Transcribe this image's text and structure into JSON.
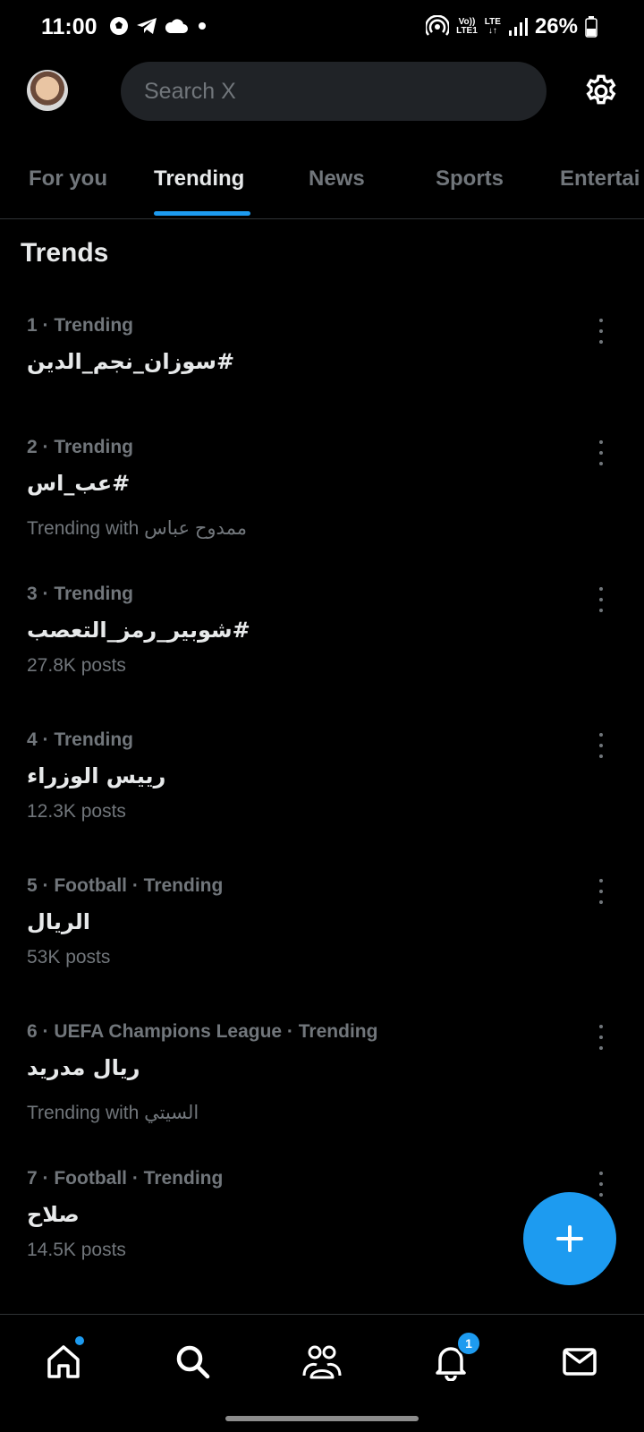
{
  "status": {
    "time": "11:00",
    "volte": "Vo))",
    "lte1": "LTE1",
    "lte": "LTE",
    "battery": "26%"
  },
  "search": {
    "placeholder": "Search X"
  },
  "tabs": [
    {
      "label": "For you"
    },
    {
      "label": "Trending"
    },
    {
      "label": "News"
    },
    {
      "label": "Sports"
    },
    {
      "label": "Entertai"
    }
  ],
  "section_title": "Trends",
  "trends": [
    {
      "meta": "1 · Trending",
      "name": "#سوزان_نجم_الدين",
      "sub": ""
    },
    {
      "meta": "2 · Trending",
      "name": "#عب_اس",
      "sub": "Trending with ممدوح عباس"
    },
    {
      "meta": "3 · Trending",
      "name": "#شوبير_رمز_التعصب",
      "sub": "27.8K posts"
    },
    {
      "meta": "4 · Trending",
      "name": "رييس الوزراء",
      "sub": "12.3K posts"
    },
    {
      "meta": "5 · Football · Trending",
      "name": "الريال",
      "sub": "53K posts"
    },
    {
      "meta": "6 · UEFA Champions League · Trending",
      "name": "ريال مدريد",
      "sub": "Trending with السيتي"
    },
    {
      "meta": "7 · Football · Trending",
      "name": "صلاح",
      "sub": "14.5K posts"
    }
  ],
  "notifications_badge": "1",
  "colors": {
    "accent": "#1d9bf0",
    "background": "#000000",
    "muted": "#71767b"
  }
}
